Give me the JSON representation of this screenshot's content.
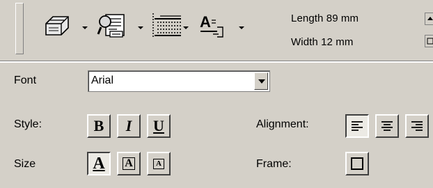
{
  "toolbar": {
    "buttons": [
      {
        "name": "print-icon"
      },
      {
        "name": "preview-icon"
      },
      {
        "name": "page-setup-icon"
      },
      {
        "name": "text-format-icon"
      }
    ],
    "length_label": "Length 89 mm",
    "width_label": "Width 12 mm"
  },
  "font": {
    "label": "Font",
    "value": "Arial"
  },
  "style": {
    "label": "Style:",
    "bold": "B",
    "italic": "I",
    "underline": "U"
  },
  "size": {
    "label": "Size",
    "large": "A",
    "medium": "A",
    "small": "A",
    "selected": "large"
  },
  "alignment": {
    "label": "Alignment:",
    "selected": "left",
    "options": [
      "left",
      "center",
      "right"
    ]
  },
  "frame": {
    "label": "Frame:"
  }
}
